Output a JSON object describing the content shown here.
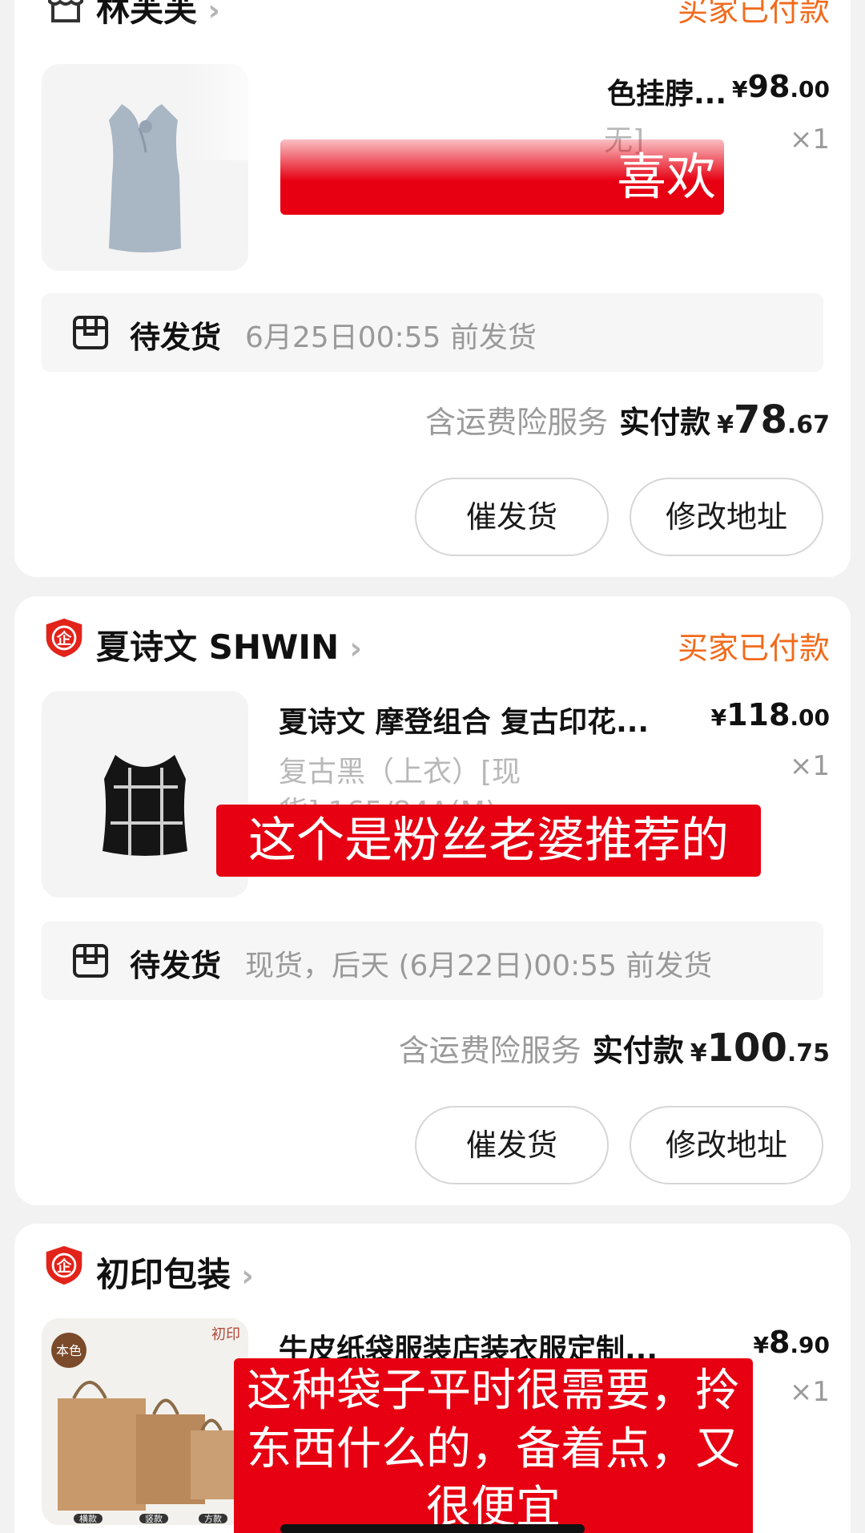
{
  "orders": [
    {
      "store": "林芙芙",
      "status": "买家已付款",
      "item_title": "色挂脖...",
      "item_sku": "无]",
      "price": {
        "currency": "¥",
        "int": "98",
        "dec": ".00"
      },
      "qty": "×1",
      "ship_label": "待发货",
      "ship_deadline": "6月25日00:55 前发货",
      "insurance": "含运费险服务",
      "paid_label": "实付款",
      "paid": {
        "currency": "¥",
        "int": "78",
        "dec": ".67"
      },
      "btn_urge": "催发货",
      "btn_address": "修改地址",
      "caption": "喜欢"
    },
    {
      "store": "夏诗文 SHWIN",
      "status": "买家已付款",
      "item_title": "夏诗文 摩登组合 复古印花...",
      "item_sku": "复古黑（上衣）[现",
      "item_sku2": "货] 165/84A(M)",
      "price": {
        "currency": "¥",
        "int": "118",
        "dec": ".00"
      },
      "qty": "×1",
      "ship_label": "待发货",
      "ship_deadline": "现货，后天 (6月22日)00:55 前发货",
      "insurance": "含运费险服务",
      "paid_label": "实付款",
      "paid": {
        "currency": "¥",
        "int": "100",
        "dec": ".75"
      },
      "btn_urge": "催发货",
      "btn_address": "修改地址",
      "caption": "这个是粉丝老婆推荐的"
    },
    {
      "store": "初印包装",
      "item_title": "牛皮纸袋服装店装衣服定制...",
      "price": {
        "currency": "¥",
        "int": "8",
        "dec": ".90"
      },
      "qty": "×1",
      "thumb_badge": "本色",
      "thumb_brand": "初印",
      "thumb_labels": [
        "横款",
        "竖款",
        "方款"
      ],
      "caption_lines": [
        "这种袋子平时很需要，拎",
        "东西什么的，备着点，又",
        "很便宜"
      ]
    }
  ],
  "icons": {
    "shop": "shop-icon",
    "enterprise": "enterprise-badge-icon",
    "package": "package-box-icon",
    "chevron": "chevron-right-icon"
  },
  "colors": {
    "status_orange": "#f26a1b",
    "caption_red": "#e60012",
    "badge_red": "#e2231a"
  }
}
